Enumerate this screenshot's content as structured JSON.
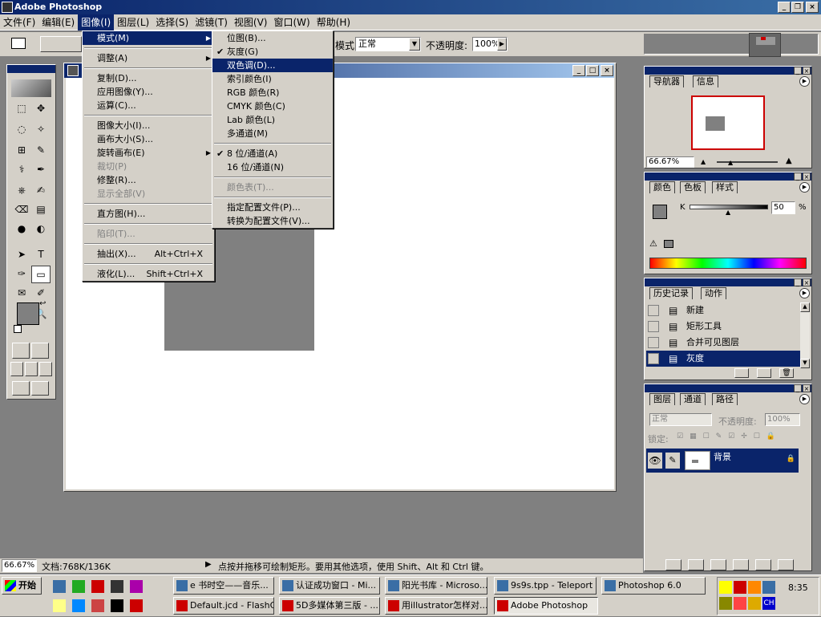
{
  "app": {
    "title": "Adobe Photoshop"
  },
  "menubar": [
    "文件(F)",
    "编辑(E)",
    "图像(I)",
    "图层(L)",
    "选择(S)",
    "滤镜(T)",
    "视图(V)",
    "窗口(W)",
    "帮助(H)"
  ],
  "options": {
    "mode_label": "模式:",
    "mode_value": "正常",
    "opacity_label": "不透明度:",
    "opacity_value": "100%"
  },
  "image_menu": [
    {
      "label": "模式(M)",
      "arrow": "▶",
      "sel": true
    },
    {
      "sep": true
    },
    {
      "label": "调整(A)",
      "arrow": "▶"
    },
    {
      "sep": true
    },
    {
      "label": "复制(D)..."
    },
    {
      "label": "应用图像(Y)..."
    },
    {
      "label": "运算(C)..."
    },
    {
      "sep": true
    },
    {
      "label": "图像大小(I)..."
    },
    {
      "label": "画布大小(S)..."
    },
    {
      "label": "旋转画布(E)",
      "arrow": "▶"
    },
    {
      "label": "裁切(P)",
      "dis": true
    },
    {
      "label": "修整(R)..."
    },
    {
      "label": "显示全部(V)",
      "dis": true
    },
    {
      "sep": true
    },
    {
      "label": "直方图(H)..."
    },
    {
      "sep": true
    },
    {
      "label": "陷印(T)...",
      "dis": true
    },
    {
      "sep": true
    },
    {
      "label": "抽出(X)...",
      "shortcut": "Alt+Ctrl+X"
    },
    {
      "sep": true
    },
    {
      "label": "液化(L)...",
      "shortcut": "Shift+Ctrl+X"
    }
  ],
  "mode_menu": [
    {
      "label": "位图(B)..."
    },
    {
      "label": "灰度(G)",
      "check": "✔"
    },
    {
      "label": "双色调(D)...",
      "sel": true
    },
    {
      "label": "索引颜色(I)"
    },
    {
      "label": "RGB 颜色(R)"
    },
    {
      "label": "CMYK 颜色(C)"
    },
    {
      "label": "Lab 颜色(L)"
    },
    {
      "label": "多通道(M)"
    },
    {
      "sep": true
    },
    {
      "label": "8 位/通道(A)",
      "check": "✔"
    },
    {
      "label": "16 位/通道(N)"
    },
    {
      "sep": true
    },
    {
      "label": "颜色表(T)...",
      "dis": true
    },
    {
      "sep": true
    },
    {
      "label": "指定配置文件(P)..."
    },
    {
      "label": "转换为配置文件(V)..."
    }
  ],
  "navigator": {
    "tabs": [
      "导航器",
      "信息"
    ],
    "zoom": "66.67%"
  },
  "color": {
    "tabs": [
      "颜色",
      "色板",
      "样式"
    ],
    "channel": "K",
    "value": "50",
    "unit": "%"
  },
  "history": {
    "tabs": [
      "历史记录",
      "动作"
    ],
    "items": [
      "新建",
      "矩形工具",
      "合并可见图层",
      "灰度"
    ]
  },
  "layers": {
    "tabs": [
      "图层",
      "通道",
      "路径"
    ],
    "blend": "正常",
    "opacity_label": "不透明度:",
    "opacity": "100%",
    "lock_label": "锁定:",
    "layer_name": "背景"
  },
  "status": {
    "zoom": "66.67%",
    "doc": "文档:768K/136K",
    "hint": "点按并拖移可绘制矩形。要用其他选项，使用 Shift、Alt 和 Ctrl 键。"
  },
  "taskbar": {
    "start": "开始",
    "row1": [
      "e 书时空——音乐...",
      "认证成功窗口 - Mi...",
      "阳光书库 - Microso...",
      "9s9s.tpp - Teleport ...",
      "Photoshop 6.0"
    ],
    "row2": [
      "Default.jcd - FlashGet",
      "5D多媒体第三版 - ...",
      "用illustrator怎样对...",
      "Adobe Photoshop"
    ],
    "time": "8:35",
    "lang": "CH"
  }
}
